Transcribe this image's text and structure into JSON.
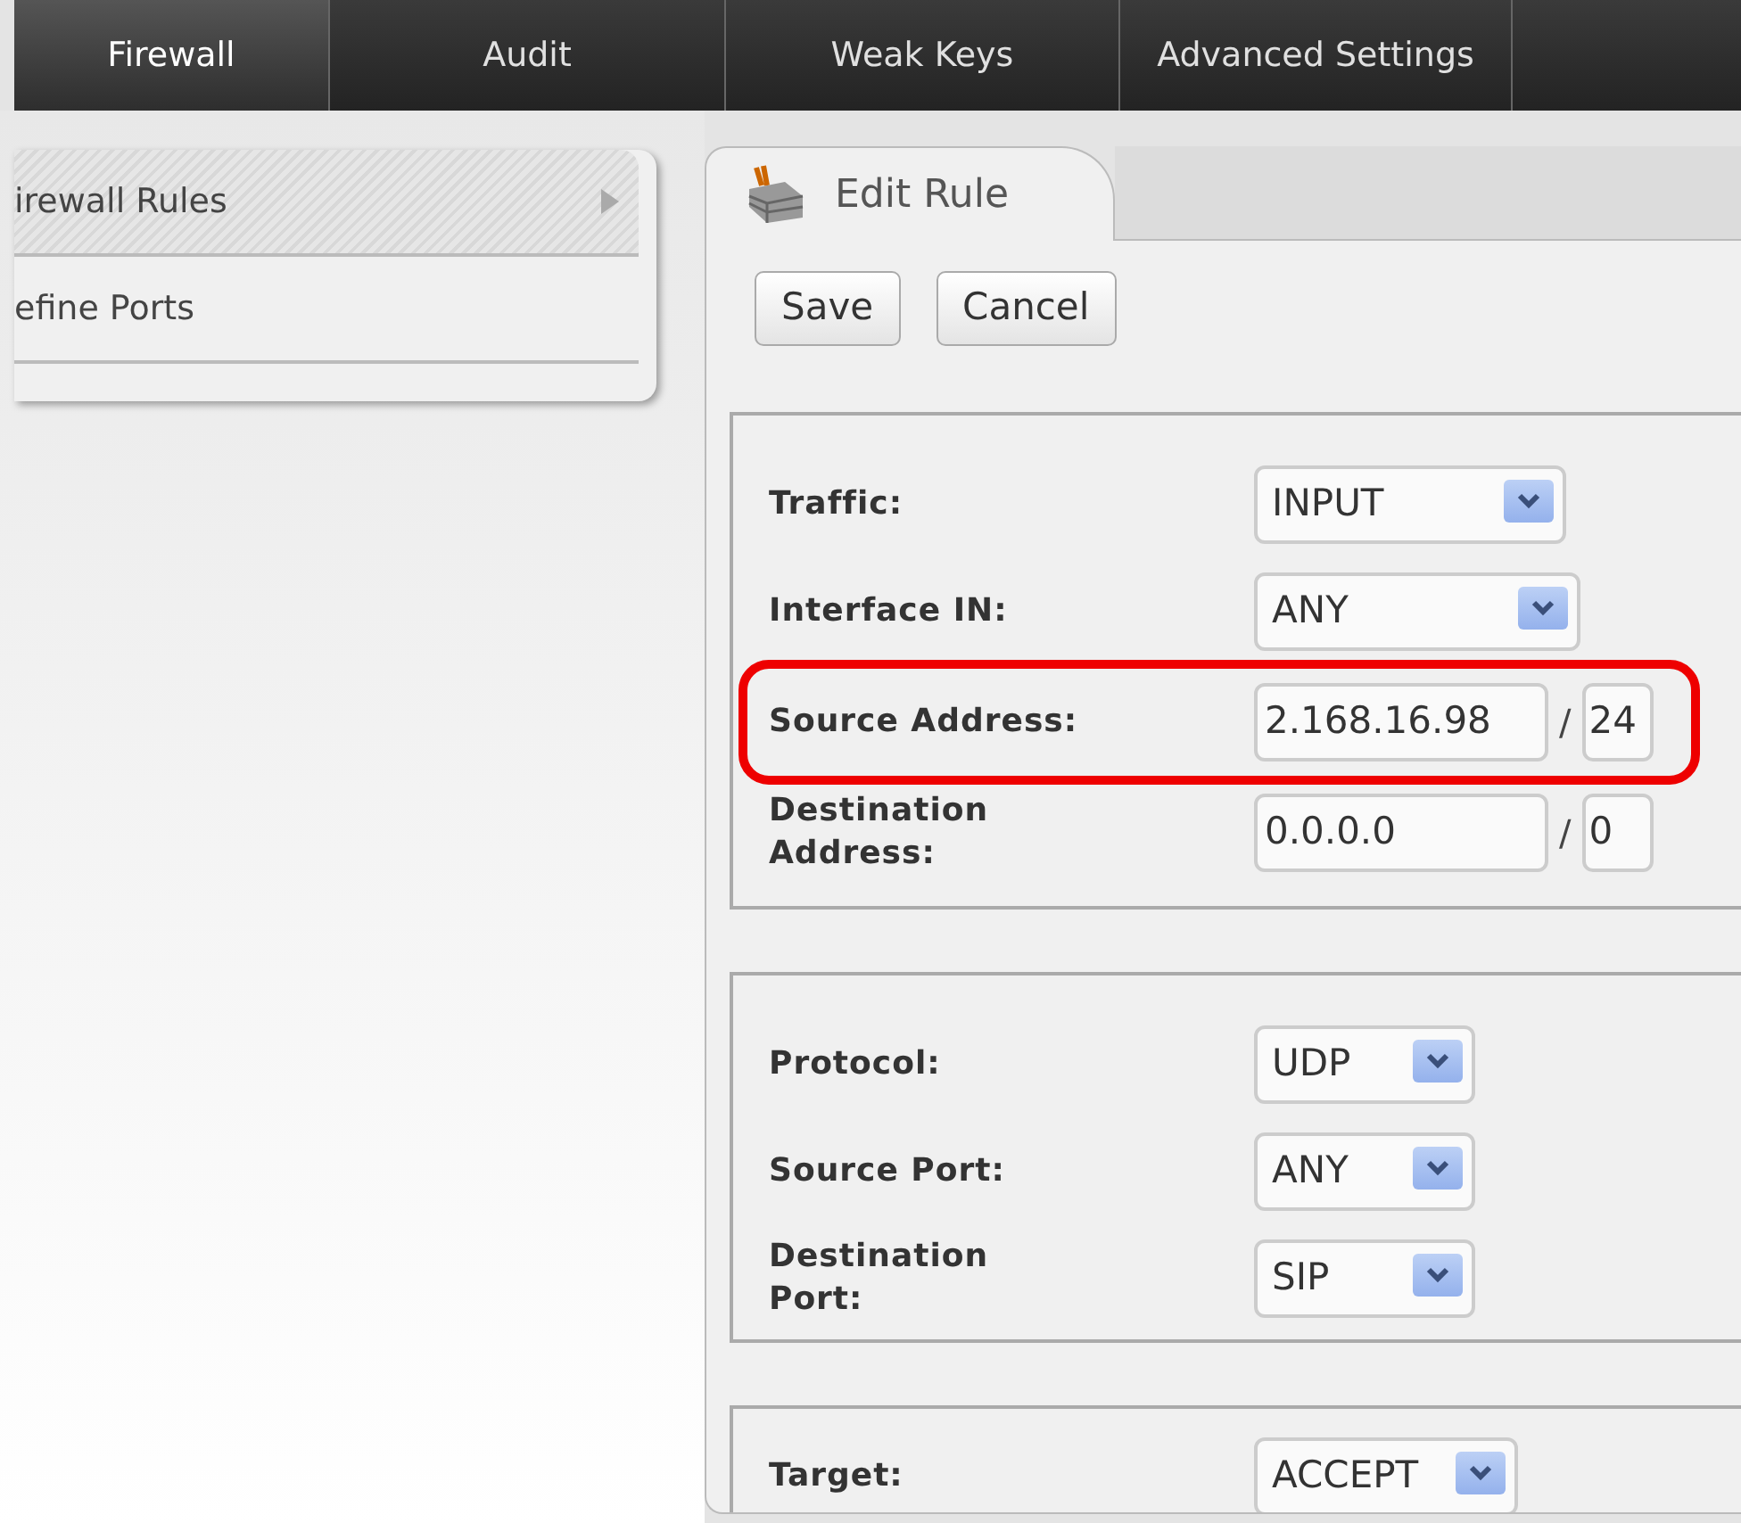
{
  "nav": [
    {
      "label": "Firewall",
      "selected": true
    },
    {
      "label": "Audit",
      "selected": false
    },
    {
      "label": "Weak Keys",
      "selected": false
    },
    {
      "label": "Advanced Settings",
      "selected": false
    }
  ],
  "sidebar": {
    "items": [
      {
        "label": "irewall Rules",
        "selected": true
      },
      {
        "label": "efine Ports",
        "selected": false
      }
    ]
  },
  "tab": {
    "title": "Edit Rule"
  },
  "buttons": [
    "Save",
    "Cancel"
  ],
  "sections": [
    {
      "fields": [
        {
          "kind": "select",
          "label": "Traffic:",
          "value": "INPUT",
          "highlighted": false
        },
        {
          "kind": "select",
          "label": "Interface IN:",
          "value": "ANY",
          "highlighted": false
        },
        {
          "kind": "address",
          "label": "Source Address:",
          "value": "2.168.16.98",
          "separator": "/",
          "prefix": "24",
          "highlighted": true
        },
        {
          "kind": "address",
          "label": "Destination Address:",
          "value": "0.0.0.0",
          "separator": "/",
          "prefix": "0",
          "highlighted": false
        }
      ]
    },
    {
      "fields": [
        {
          "kind": "select",
          "label": "Protocol:",
          "value": "UDP",
          "highlighted": false
        },
        {
          "kind": "select",
          "label": "Source Port:",
          "value": "ANY",
          "highlighted": false
        },
        {
          "kind": "select",
          "label": "Destination Port:",
          "value": "SIP",
          "highlighted": false
        }
      ]
    },
    {
      "fields": [
        {
          "kind": "select",
          "label": "Target:",
          "value": "ACCEPT",
          "highlighted": false
        }
      ]
    }
  ]
}
